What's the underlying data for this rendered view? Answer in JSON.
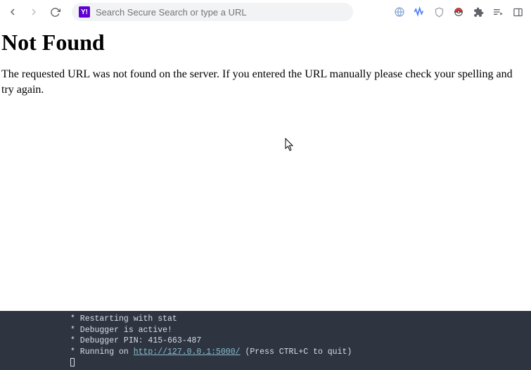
{
  "toolbar": {
    "search_placeholder": "Search Secure Search or type a URL",
    "yahoo_label": "Y!"
  },
  "page": {
    "heading": "Not Found",
    "body_line1": "The requested URL was not found on the server. If you entered the URL manually please check your spelling and",
    "body_line2": "try again."
  },
  "terminal": {
    "line1": " * Restarting with stat",
    "line2": " * Debugger is active!",
    "line3": " * Debugger PIN: 415-663-487",
    "line4_prefix": " * Running on ",
    "line4_url": "http://127.0.0.1:5000/",
    "line4_suffix": " (Press CTRL+C to quit)"
  }
}
